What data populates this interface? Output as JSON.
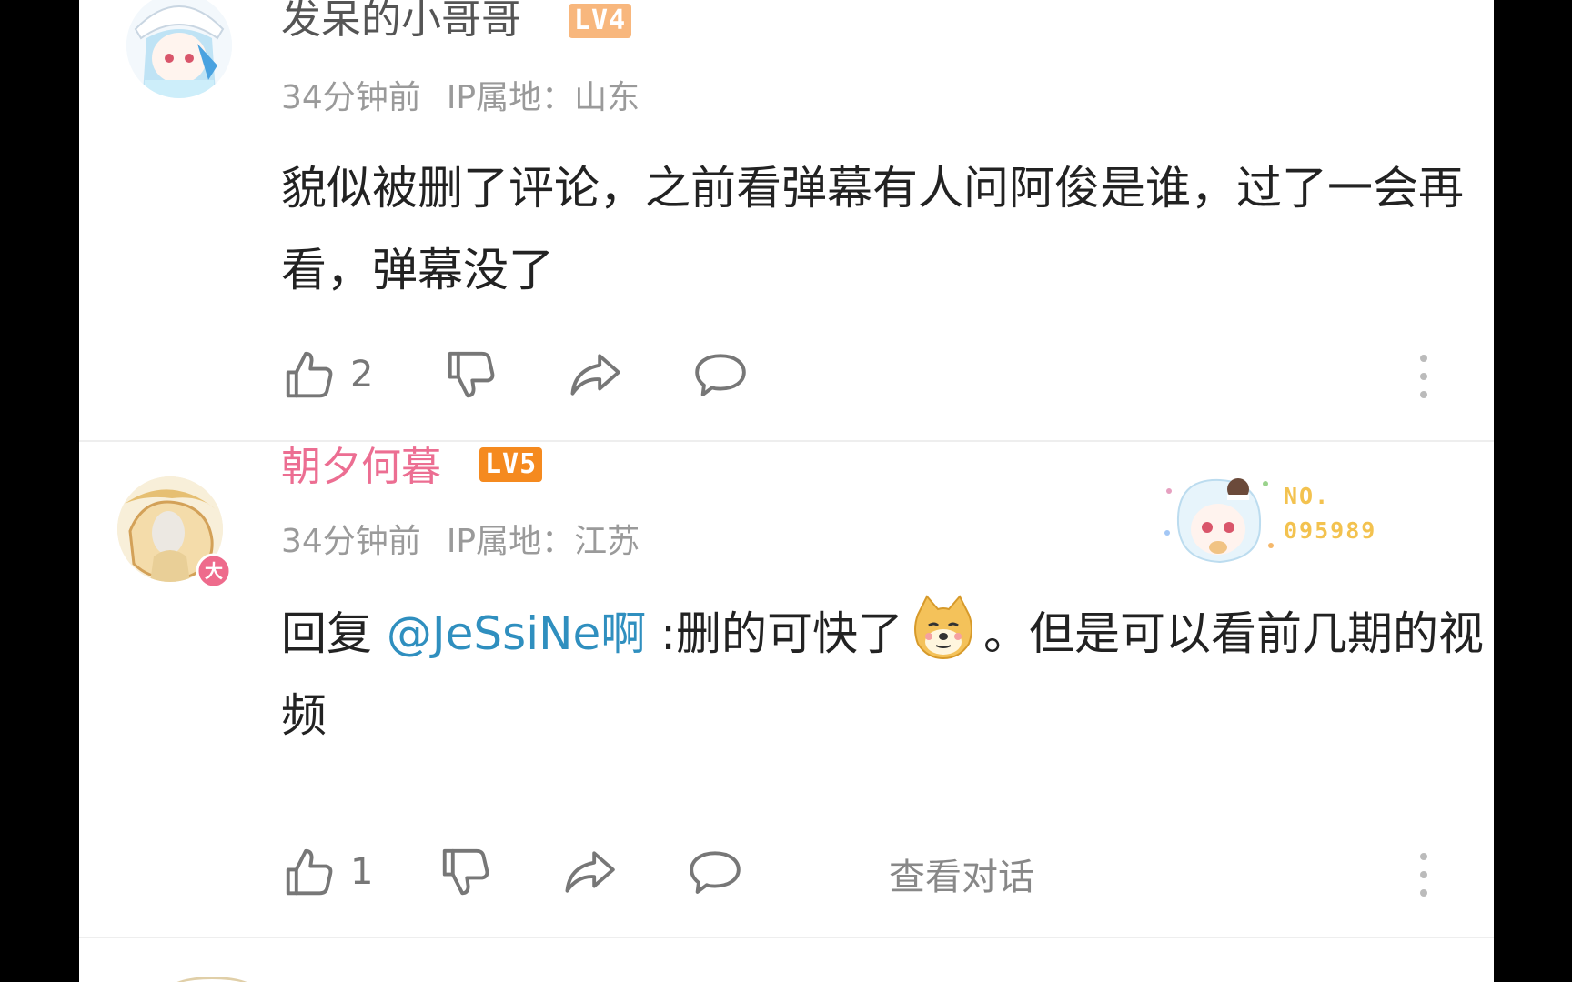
{
  "comments": [
    {
      "username": "发呆的小哥哥",
      "level": "LV4",
      "time": "34分钟前",
      "ip_location": "IP属地：山东",
      "text": "貌似被删了评论，之前看弹幕有人问阿俊是谁，过了一会再看，弹幕没了",
      "likes": "2",
      "name_color": "#555555",
      "level_color": "#f8b77d"
    },
    {
      "username": "朝夕何暮",
      "level": "LV5",
      "time": "34分钟前",
      "ip_location": "IP属地：江苏",
      "reply_prefix": "回复 ",
      "reply_mention": "@JeSsiNe啊",
      "reply_text_before_emoji": " :删的可快了",
      "reply_text_after_emoji": "。但是可以看前几期的视频",
      "likes": "1",
      "view_conversation": "查看对话",
      "badge_no_label": "NO.",
      "badge_number": "095989",
      "avatar_badge_char": "大",
      "name_color": "#ec6e92",
      "level_color": "#f58a1f"
    }
  ],
  "icons": {
    "like": "thumbs-up-icon",
    "dislike": "thumbs-down-icon",
    "share": "share-icon",
    "reply": "comment-icon",
    "more": "more-vertical-icon",
    "emoji": "doge-emoji"
  },
  "colors": {
    "mention": "#2f8fbf",
    "meta": "#9a9a9a",
    "badge": "#f3c24f"
  }
}
